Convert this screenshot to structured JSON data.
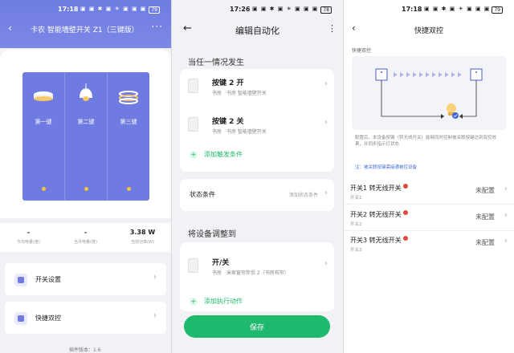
{
  "status_bars": [
    {
      "time": "17:18",
      "icons": "▣ ▣ ✱ ▣ ☀ ▣ ▣ ▣",
      "battery": "79"
    },
    {
      "time": "17:26",
      "icons": "▣ ▣ ✱ ▣ ☀ ▣ ▣ ▣",
      "battery": "78"
    },
    {
      "time": "17:18",
      "icons": "▣ ▣ ✱ ▣ ☀ ▣ ▣ ▣",
      "battery": "79"
    }
  ],
  "panel1": {
    "title": "卡农 智能墙壁开关 Z1（三键版）",
    "keys": [
      "第一键",
      "第二键",
      "第三键"
    ],
    "stats": [
      {
        "value": "-",
        "label": "今日电量(度)"
      },
      {
        "value": "-",
        "label": "当月电量(度)"
      },
      {
        "value": "3.38 W",
        "label": "当前功率(W)"
      }
    ],
    "menu": [
      {
        "label": "开关设置"
      },
      {
        "label": "快捷双控"
      }
    ],
    "plugin_version": "插件版本：1.6"
  },
  "panel2": {
    "title": "编辑自动化",
    "trigger_heading": "当任一情况发生",
    "triggers": [
      {
        "name": "按键 2 开",
        "sub": "书房　书房 智能墙壁开关"
      },
      {
        "name": "按键 2 关",
        "sub": "书房　书房 智能墙壁开关"
      }
    ],
    "add_trigger": "添加触发条件",
    "state_label": "状态条件",
    "state_hint": "添加状态条件",
    "action_heading": "将设备调整到",
    "actions": [
      {
        "name": "开/关",
        "sub": "书房　米家窗帘伴侣 2（书房布帘）"
      }
    ],
    "add_action": "添加执行动作",
    "save": "保存"
  },
  "panel3": {
    "title": "快捷双控",
    "caption": "快捷双控",
    "description": "配置后，本设备按键（转无线开关）能够同时控制被关联按键达到双控效果，并同步指示灯状态",
    "note": "注：被关联按键需接通被控设备",
    "rows": [
      {
        "name": "开关1 转无线开关",
        "sub": "开关1",
        "value": "未配置"
      },
      {
        "name": "开关2 转无线开关",
        "sub": "开关2",
        "value": "未配置"
      },
      {
        "name": "开关3 转无线开关",
        "sub": "开关3",
        "value": "未配置"
      }
    ]
  },
  "colors": {
    "accent_blue": "#6f7be0",
    "accent_green": "#1fb96e",
    "warning_red": "#e5483a",
    "indicator_yellow": "#f4c43a"
  }
}
